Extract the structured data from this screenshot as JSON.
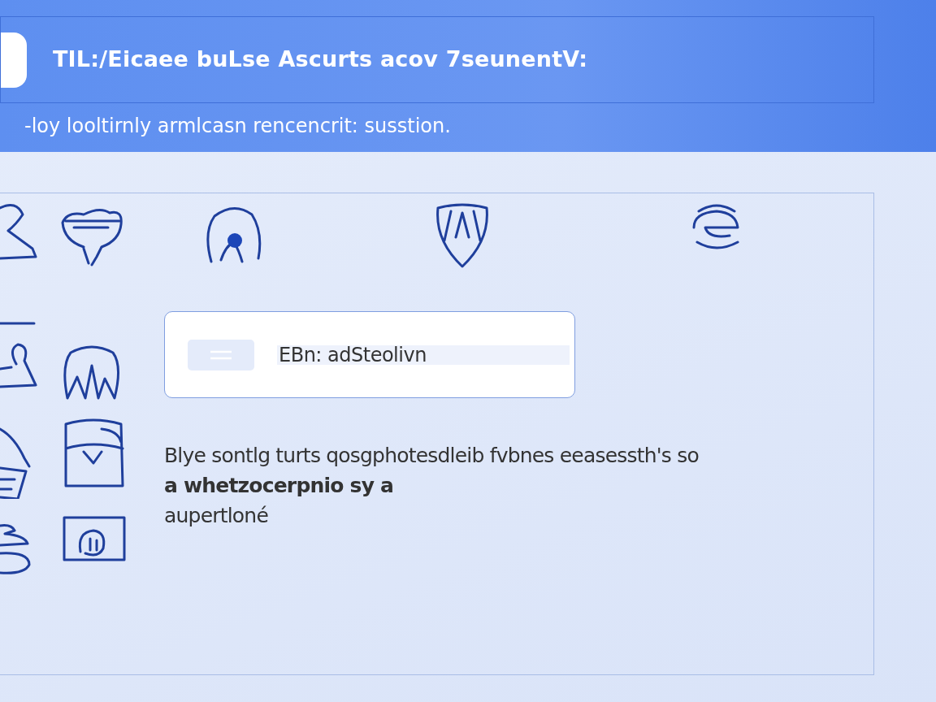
{
  "header": {
    "title": "TIL:/Eicaee buLse Ascurts acov 7seunentV:",
    "subtitle": "-loy looltirnly armlcasn rencencrit: susstion."
  },
  "field": {
    "value": "EBn: adSteolivn"
  },
  "description": {
    "lines": [
      "Blye sontlg turts qosgphotesdleib fvbnes eeasessth's so",
      "**a whetzocerpnio sy a**",
      "aupertloné"
    ]
  }
}
